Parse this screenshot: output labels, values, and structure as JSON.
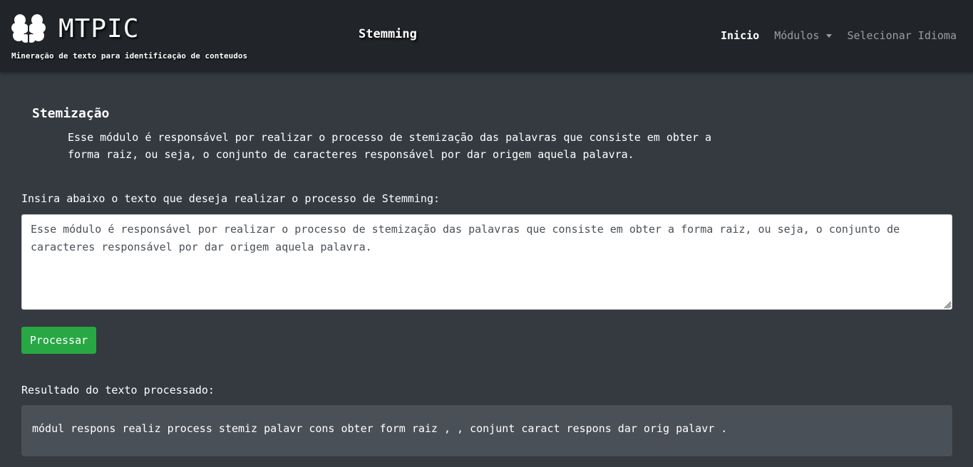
{
  "brand": {
    "title": "MTPIC",
    "subtitle": "Mineração de texto para identificação de conteudos",
    "logo_icon": "brain-icon"
  },
  "header": {
    "page_title": "Stemming"
  },
  "nav": {
    "inicio": "Inicio",
    "modulos": "Módulos",
    "idioma": "Selecionar Idioma"
  },
  "section": {
    "title": "Stemização",
    "description": "Esse módulo é responsável por realizar o processo de stemização das palavras que consiste em obter a forma raiz, ou seja, o conjunto de caracteres responsável por dar origem aquela palavra."
  },
  "input": {
    "label": "Insira abaixo o texto que deseja realizar o processo de Stemming:",
    "value": "Esse módulo é responsável por realizar o processo de stemização das palavras que consiste em obter a forma raiz, ou seja, o conjunto de caracteres responsável por dar origem aquela palavra."
  },
  "actions": {
    "process_label": "Processar"
  },
  "result": {
    "label": "Resultado do texto processado:",
    "text": "módul respons realiz process stemiz palavr cons obter form raiz , , conjunt caract respons dar orig palavr ."
  },
  "colors": {
    "navbar": "#212529",
    "background": "#343a40",
    "button": "#28a745",
    "result_box": "#495057"
  }
}
